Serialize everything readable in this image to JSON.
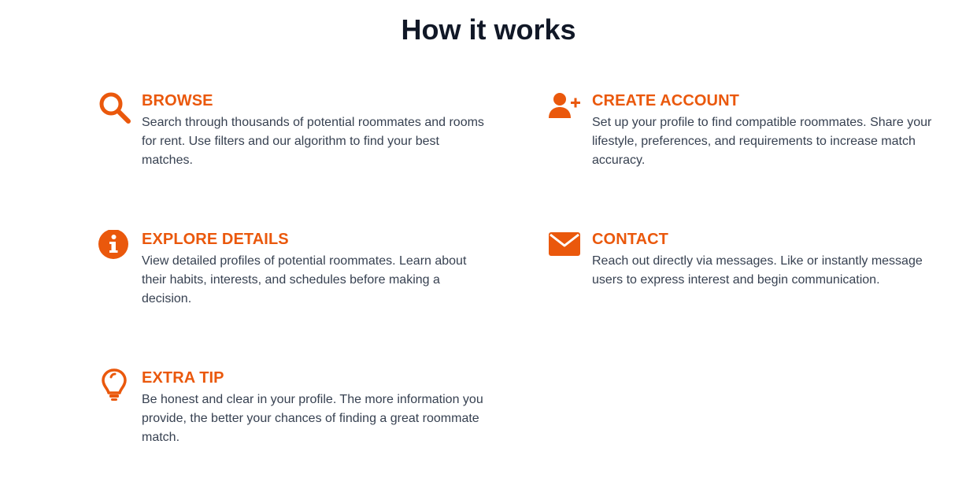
{
  "section": {
    "title": "How it works"
  },
  "accent_color": "#ea580c",
  "steps": [
    {
      "icon": "search-icon",
      "heading": "BROWSE",
      "description": "Search through thousands of potential roommates and rooms for rent. Use filters and our algorithm to find your best matches."
    },
    {
      "icon": "user-plus-icon",
      "heading": "CREATE ACCOUNT",
      "description": "Set up your profile to find compatible roommates. Share your lifestyle, preferences, and requirements to increase match accuracy."
    },
    {
      "icon": "info-icon",
      "heading": "EXPLORE DETAILS",
      "description": "View detailed profiles of potential roommates. Learn about their habits, interests, and schedules before making a decision."
    },
    {
      "icon": "envelope-icon",
      "heading": "CONTACT",
      "description": "Reach out directly via messages. Like or instantly message users to express interest and begin communication."
    },
    {
      "icon": "lightbulb-icon",
      "heading": "EXTRA TIP",
      "description": "Be honest and clear in your profile. The more information you provide, the better your chances of finding a great roommate match."
    }
  ]
}
